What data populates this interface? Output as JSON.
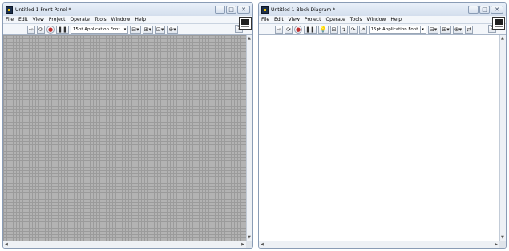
{
  "front_panel": {
    "title": "Untitled 1 Front Panel *",
    "menu": [
      "File",
      "Edit",
      "View",
      "Project",
      "Operate",
      "Tools",
      "Window",
      "Help"
    ],
    "toolbar": {
      "run_arrow": "⇨",
      "run_continuous": "⟳",
      "abort": "●",
      "pause": "❚❚",
      "font": "15pt Application Font",
      "font_arrow": "▾",
      "align": "⊟▾",
      "distribute": "⊞▾",
      "resize": "⊡▾",
      "reorder": "⊕▾",
      "help": "?"
    }
  },
  "block_diagram": {
    "title": "Untitled 1 Block Diagram *",
    "menu": [
      "File",
      "Edit",
      "View",
      "Project",
      "Operate",
      "Tools",
      "Window",
      "Help"
    ],
    "toolbar": {
      "run_arrow": "⇨",
      "run_continuous": "⟳",
      "abort": "●",
      "pause": "❚❚",
      "highlight": "💡",
      "retain": "⊟",
      "step_into": "↴",
      "step_over": "↷",
      "step_out": "↗",
      "font": "15pt Application Font",
      "font_arrow": "▾",
      "align": "⊟▾",
      "distribute": "⊞▾",
      "reorder": "⊕▾",
      "cleanup": "⇄",
      "help": "?"
    }
  },
  "window_buttons": {
    "minimize": "–",
    "maximize": "□",
    "close": "✕"
  },
  "scroll_arrows": {
    "up": "▲",
    "down": "▼",
    "left": "◀",
    "right": "▶"
  }
}
